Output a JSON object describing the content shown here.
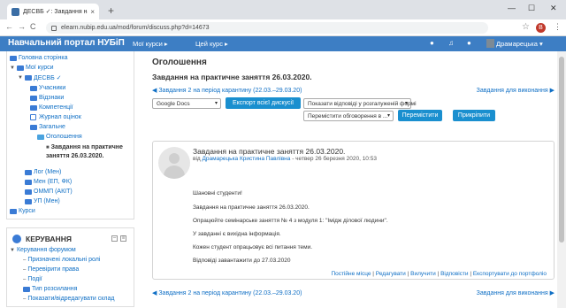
{
  "browser": {
    "tab_title": "ДЕСВБ ✓: Завдання на практич",
    "close_glyph": "×",
    "new_tab_glyph": "+",
    "url": "elearn.nubip.edu.ua/mod/forum/discuss.php?d=14673",
    "profile_letter": "В",
    "win_min": "—",
    "win_max": "☐",
    "win_close": "✕",
    "back": "←",
    "forward": "→",
    "reload": "C",
    "star": "☆",
    "menu": "⋮"
  },
  "navbar": {
    "brand": "Навчальний портал НУБіП",
    "my_courses": "Мої курси ▸",
    "this_course": "Цей курс ▸",
    "user_name": "Драмарецька ▾",
    "icons": [
      "info-icon",
      "bell-icon",
      "chat-icon"
    ]
  },
  "nav_block": {
    "items": [
      {
        "label": "Головна сторінка",
        "kind": "link"
      },
      {
        "label": "Мої курси",
        "kind": "heading"
      },
      {
        "label": "ДЕСВБ ✓",
        "kind": "link"
      },
      {
        "label": "Учасники",
        "kind": "link"
      },
      {
        "label": "Відзнаки",
        "kind": "link"
      },
      {
        "label": "Компетенції",
        "kind": "link"
      },
      {
        "label": "Журнал оцінок",
        "kind": "link"
      },
      {
        "label": "Загальне",
        "kind": "link"
      },
      {
        "label": "Оголошення",
        "kind": "link"
      },
      {
        "label": "Завдання на практичне заняття 26.03.2020.",
        "kind": "active"
      },
      {
        "label": "Лог (Мен)",
        "kind": "link"
      },
      {
        "label": "Мен (ЕП, ФК)",
        "kind": "link"
      },
      {
        "label": "ОММП (АКІТ)",
        "kind": "link"
      },
      {
        "label": "УП (Мен)",
        "kind": "link"
      },
      {
        "label": "Курси",
        "kind": "link"
      }
    ]
  },
  "admin_block": {
    "title": "КЕРУВАННЯ",
    "items": [
      {
        "label": "Керування форумом"
      },
      {
        "label": "Призначені локальні ролі"
      },
      {
        "label": "Перевірити права"
      },
      {
        "label": "Події"
      },
      {
        "label": "Тип розсилання"
      },
      {
        "label": "Показати/відредагувати склад"
      }
    ],
    "collapse_glyph": "–",
    "menu_glyph": "≡"
  },
  "main": {
    "heading": "Оголошення",
    "discussion_title": "Завдання на практичне заняття 26.03.2020.",
    "prev_link": "◀ Завдання 2 на період карантину (22.03.–29.03.20)",
    "next_link": "Завдання для виконання ▶",
    "export_select": "Google Docs",
    "export_button": "Експорт всієї дискусії",
    "display_select": "Показати відповіді у розгалуженій формі",
    "move_select": "Перемістити обговорення в ...",
    "move_button": "Перемістити",
    "pin_button": "Прикріпити",
    "post": {
      "title": "Завдання на практичне заняття 26.03.2020.",
      "by_prefix": "від",
      "author": "Драмарецька Кристина Павлівна",
      "date": "- четвер 26 березня 2020, 10:53",
      "lines": [
        "Шановні студенти!",
        "Завдання на практичне заняття 26.03.2020.",
        "Опрацюйте семінарське заняття № 4 з модуля 1: \"Імідж ділової людини\".",
        "У завданні є вихідна інформація.",
        "Кожен студент опрацьовує всі питання теми.",
        "Відповіді завантажити до 27.03.2020"
      ],
      "commands": [
        "Постійне місце",
        "Редагувати",
        "Вилучити",
        "Відповісти",
        "Експортувати до портфоліо"
      ]
    },
    "bottom_prev_link": "◀ Завдання 2 на період карантину (22.03.–29.03.20)",
    "bottom_next_link": "Завдання для виконання ▶"
  }
}
